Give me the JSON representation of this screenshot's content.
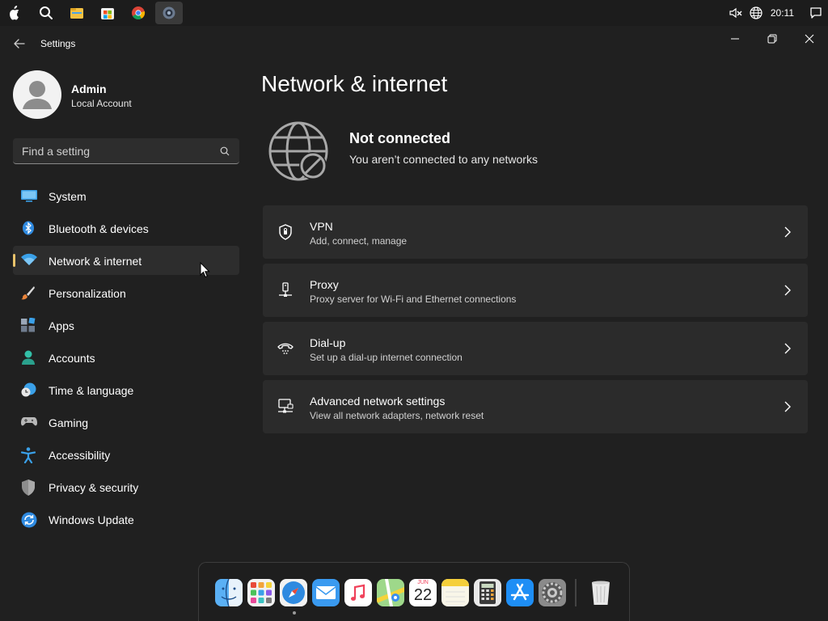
{
  "taskbar": {
    "clock": "20:11",
    "apps": [
      "apple-icon",
      "search-icon",
      "file-explorer-icon",
      "store-icon",
      "chrome-icon",
      "settings-app-icon"
    ]
  },
  "window": {
    "title": "Settings"
  },
  "profile": {
    "name": "Admin",
    "account_type": "Local Account"
  },
  "search": {
    "placeholder": "Find a setting"
  },
  "sidebar": {
    "items": [
      {
        "label": "System",
        "icon": "system-icon"
      },
      {
        "label": "Bluetooth & devices",
        "icon": "bluetooth-icon"
      },
      {
        "label": "Network & internet",
        "icon": "wifi-icon",
        "selected": true
      },
      {
        "label": "Personalization",
        "icon": "brush-icon"
      },
      {
        "label": "Apps",
        "icon": "apps-icon"
      },
      {
        "label": "Accounts",
        "icon": "person-icon"
      },
      {
        "label": "Time & language",
        "icon": "clock-globe-icon"
      },
      {
        "label": "Gaming",
        "icon": "gamepad-icon"
      },
      {
        "label": "Accessibility",
        "icon": "accessibility-icon"
      },
      {
        "label": "Privacy & security",
        "icon": "shield-icon"
      },
      {
        "label": "Windows Update",
        "icon": "update-icon"
      }
    ]
  },
  "main": {
    "title": "Network & internet",
    "status": {
      "title": "Not connected",
      "subtitle": "You aren’t connected to any networks"
    },
    "cards": [
      {
        "title": "VPN",
        "subtitle": "Add, connect, manage",
        "icon": "vpn-shield-icon"
      },
      {
        "title": "Proxy",
        "subtitle": "Proxy server for Wi-Fi and Ethernet connections",
        "icon": "proxy-icon"
      },
      {
        "title": "Dial-up",
        "subtitle": "Set up a dial-up internet connection",
        "icon": "dialup-icon"
      },
      {
        "title": "Advanced network settings",
        "subtitle": "View all network adapters, network reset",
        "icon": "network-adapter-icon"
      }
    ]
  },
  "dock": {
    "calendar_month": "JUN",
    "calendar_day": "22"
  },
  "colors": {
    "background": "#202020",
    "card": "#2b2b2b",
    "accent": "#e8c36b"
  }
}
